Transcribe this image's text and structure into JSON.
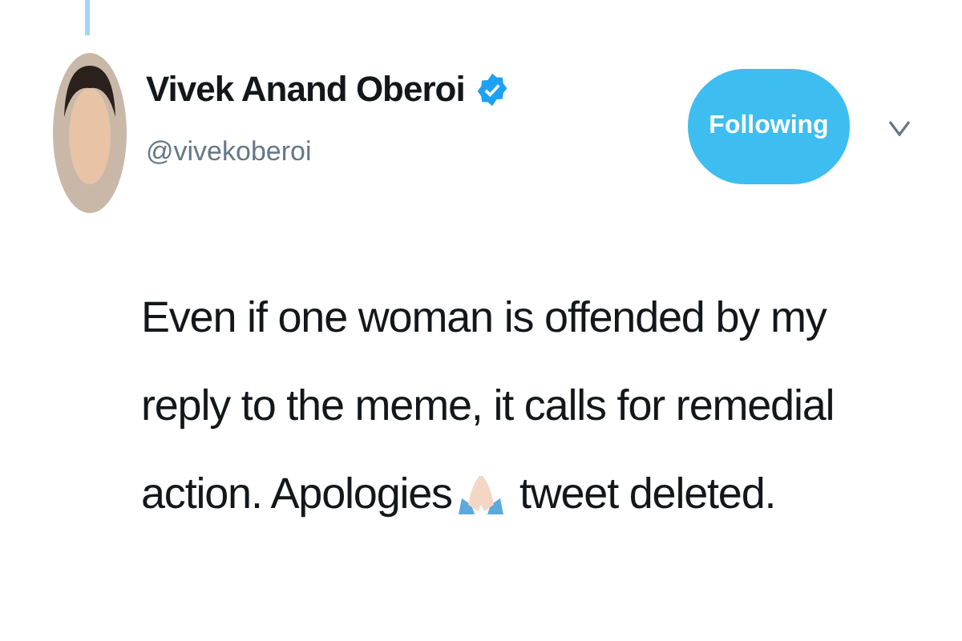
{
  "author": {
    "name": "Vivek Anand Oberoi",
    "verified": true,
    "handle": "@vivekoberoi"
  },
  "follow_button": {
    "label": "Following",
    "selected": true
  },
  "tweet": {
    "lines": [
      "Even if one woman is offended by my",
      "reply to the meme, it calls for remedial"
    ],
    "last_line_before_emoji": "action. Apologies",
    "last_line_after_emoji": "tweet deleted."
  }
}
